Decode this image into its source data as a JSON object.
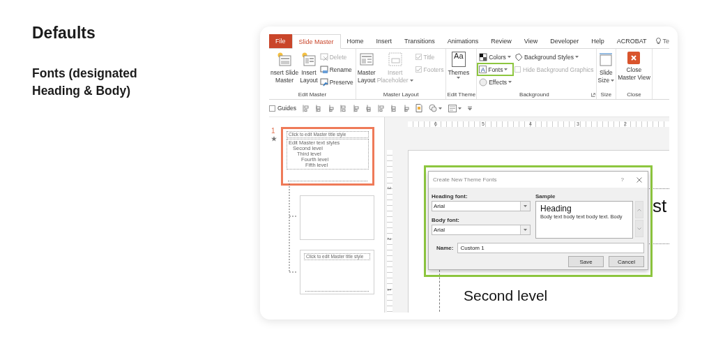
{
  "heading": "Defaults",
  "subheading": "Fonts (designated Heading & Body)",
  "tabs": [
    {
      "label": "File",
      "kind": "file",
      "selected": false
    },
    {
      "label": "Slide Master",
      "kind": "tab",
      "selected": true
    },
    {
      "label": "Home",
      "kind": "tab",
      "selected": false
    },
    {
      "label": "Insert",
      "kind": "tab",
      "selected": false
    },
    {
      "label": "Transitions",
      "kind": "tab",
      "selected": false
    },
    {
      "label": "Animations",
      "kind": "tab",
      "selected": false
    },
    {
      "label": "Review",
      "kind": "tab",
      "selected": false
    },
    {
      "label": "View",
      "kind": "tab",
      "selected": false
    },
    {
      "label": "Developer",
      "kind": "tab",
      "selected": false
    },
    {
      "label": "Help",
      "kind": "tab",
      "selected": false
    },
    {
      "label": "ACROBAT",
      "kind": "tab",
      "selected": false
    },
    {
      "label": "Te",
      "kind": "tell",
      "selected": false
    }
  ],
  "ribbon": {
    "groups": [
      {
        "label": "Edit Master",
        "columns": [
          {
            "kind": "large",
            "lines": [
              "nsert Slide",
              "Master"
            ],
            "disabled": false
          },
          {
            "kind": "large",
            "lines": [
              "Insert",
              "Layout"
            ],
            "disabled": false
          },
          {
            "kind": "stack",
            "items": [
              {
                "kind": "small",
                "label": "Delete",
                "disabled": true,
                "highlighted": false
              },
              {
                "kind": "small",
                "label": "Rename",
                "disabled": false,
                "highlighted": false
              },
              {
                "kind": "small",
                "label": "Preserve",
                "disabled": false,
                "highlighted": false
              }
            ]
          }
        ]
      },
      {
        "label": "Master Layout",
        "columns": [
          {
            "kind": "large",
            "lines": [
              "Master",
              "Layout"
            ],
            "disabled": false
          },
          {
            "kind": "large",
            "lines": [
              "Insert",
              "Placeholder"
            ],
            "disabled": true,
            "dropdown": true
          },
          {
            "kind": "stack",
            "items": [
              {
                "kind": "check",
                "label": "Title",
                "checked": true,
                "disabled": true
              },
              {
                "kind": "check",
                "label": "Footers",
                "checked": true,
                "disabled": true
              }
            ]
          }
        ]
      },
      {
        "label": "Edit Theme",
        "columns": [
          {
            "kind": "large",
            "lines": [
              "Themes"
            ],
            "icon_text": "Aa",
            "disabled": false,
            "dropdown": true
          }
        ]
      },
      {
        "label": "Background",
        "launcher": true,
        "columns": [
          {
            "kind": "stack",
            "items": [
              {
                "kind": "small",
                "label": "Colors",
                "disabled": false,
                "dropdown": true,
                "highlighted": false
              },
              {
                "kind": "small",
                "label": "Fonts",
                "icon_text": "A",
                "disabled": false,
                "dropdown": true,
                "highlighted": true
              },
              {
                "kind": "small",
                "label": "Effects",
                "disabled": false,
                "dropdown": true,
                "highlighted": false
              }
            ]
          },
          {
            "kind": "stack",
            "items": [
              {
                "kind": "small",
                "label": "Background Styles",
                "disabled": false,
                "dropdown": true,
                "highlighted": false
              },
              {
                "kind": "check",
                "label": "Hide Background Graphics",
                "checked": false,
                "disabled": true
              }
            ]
          }
        ]
      },
      {
        "label": "Size",
        "columns": [
          {
            "kind": "large",
            "lines": [
              "Slide",
              "Size"
            ],
            "disabled": false,
            "dropdown": true
          }
        ]
      },
      {
        "label": "Close",
        "columns": [
          {
            "kind": "large",
            "lines": [
              "Close",
              "Master View"
            ],
            "disabled": false
          }
        ]
      }
    ]
  },
  "toolbar": {
    "guides": {
      "label": "Guides",
      "checked": false
    }
  },
  "thumbnails": [
    {
      "number": "1",
      "selected": true,
      "title": "Click to edit Master title style",
      "lines": [
        "Edit Master text styles",
        "Second level",
        "Third level",
        "Fourth level",
        "Fifth level"
      ],
      "children": [
        {
          "selected": false
        },
        {
          "selected": false,
          "title": "Click to edit Master title style"
        }
      ]
    }
  ],
  "horizontal_ruler": [
    "6",
    "5",
    "4",
    "3",
    "2"
  ],
  "vertical_ruler": [
    "3",
    "2",
    "1"
  ],
  "slide": {
    "title_fragment": "st",
    "body_text": "Second level"
  },
  "dialog": {
    "title": "Create New Theme Fonts",
    "help": "?",
    "heading_font": {
      "label": "Heading font:",
      "value": "Arial"
    },
    "body_font": {
      "label": "Body font:",
      "value": "Arial"
    },
    "sample": {
      "label": "Sample",
      "heading": "Heading",
      "body": "Body text body text body text. Body"
    },
    "name": {
      "label": "Name:",
      "value": "Custom 1"
    },
    "buttons": [
      "Save",
      "Cancel"
    ]
  }
}
